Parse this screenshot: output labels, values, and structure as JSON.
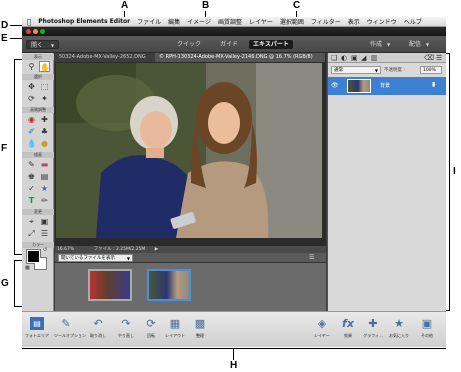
{
  "callouts": {
    "A": "A",
    "B": "B",
    "C": "C",
    "D": "D",
    "E": "E",
    "F": "F",
    "G": "G",
    "H": "H",
    "I": "I"
  },
  "menubar": {
    "app_name": "Photoshop Elements Editor",
    "items": [
      "ファイル",
      "編集",
      "イメージ",
      "画質調整",
      "レイヤー",
      "選択範囲",
      "フィルター",
      "表示",
      "ウィンドウ",
      "ヘルプ"
    ]
  },
  "modebar": {
    "open_label": "開く",
    "tabs": [
      {
        "label": "クイック"
      },
      {
        "label": "ガイド"
      },
      {
        "label": "エキスパート"
      }
    ],
    "create_label": "作成",
    "share_label": "配信"
  },
  "toolbox": {
    "sections": [
      "表示",
      "選択",
      "画質調整",
      "描画",
      "変更",
      "カラー"
    ]
  },
  "canvas": {
    "tab1": "50324-Adobe-MX-Valley-2652.DNG",
    "tab2": "© RPH-130324-Adobe-MX-Valley-2146.DNG @ 16.7% (RGB/8)",
    "zoom": "16.67%",
    "file_info": "ファイル : 2.25M/2.25M"
  },
  "bin": {
    "dropdown": "開いているファイルを表示"
  },
  "panel": {
    "blend_mode": "通常",
    "opacity_label": "不透明度 :",
    "opacity_value": "100%",
    "layer_name": "背景"
  },
  "bottombar": {
    "left": [
      {
        "label": "フォトエリア",
        "icon": "photo-bin-icon"
      },
      {
        "label": "ツールオプション",
        "icon": "tool-options-icon"
      },
      {
        "label": "取り消し",
        "icon": "undo-icon"
      },
      {
        "label": "やり直し",
        "icon": "redo-icon"
      },
      {
        "label": "回転",
        "icon": "rotate-icon"
      },
      {
        "label": "レイアウト",
        "icon": "layout-icon"
      },
      {
        "label": "整理",
        "icon": "organizer-icon"
      }
    ],
    "right": [
      {
        "label": "レイヤー",
        "icon": "layers-icon"
      },
      {
        "label": "効果",
        "icon": "fx-icon"
      },
      {
        "label": "グラフィ...",
        "icon": "graphics-icon"
      },
      {
        "label": "お気に入り",
        "icon": "favorites-icon"
      },
      {
        "label": "その他",
        "icon": "more-icon"
      }
    ]
  }
}
